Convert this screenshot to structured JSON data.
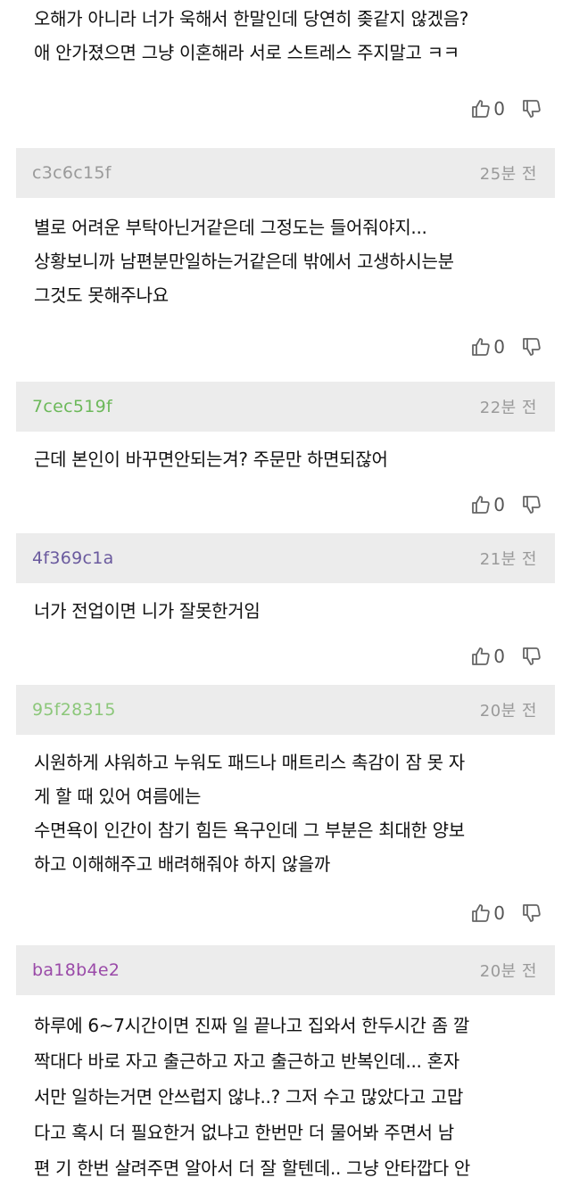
{
  "comments": [
    {
      "user": "",
      "time": "",
      "lines": [
        "오해가 아니라 너가 욱해서 한말인데 당연히 좆같지 않겠음?",
        "애 안가졌으면 그냥 이혼해라 서로 스트레스 주지말고 ㅋㅋ"
      ],
      "likes": "0",
      "user_color": "#999999"
    },
    {
      "user": "c3c6c15f",
      "time": "25분 전",
      "lines": [
        "별로 어려운 부탁아닌거같은데 그정도는 들어줘야지...",
        "상황보니까 남편분만일하는거같은데 밖에서 고생하시는분",
        "그것도 못해주나요"
      ],
      "likes": "0",
      "user_color": "#9a9a9a"
    },
    {
      "user": "7cec519f",
      "time": "22분 전",
      "lines": [
        "근데 본인이 바꾸면안되는겨? 주문만 하면되잖어"
      ],
      "likes": "0",
      "user_color": "#6cb85a"
    },
    {
      "user": "4f369c1a",
      "time": "21분 전",
      "lines": [
        "너가 전업이면 니가 잘못한거임"
      ],
      "likes": "0",
      "user_color": "#6a5a9e"
    },
    {
      "user": "95f28315",
      "time": "20분 전",
      "lines": [
        "시원하게 샤워하고 누워도 패드나 매트리스 촉감이 잠 못 자",
        "게 할 때 있어 여름에는",
        "수면욕이 인간이 참기 힘든 욕구인데 그 부분은 최대한 양보",
        "하고 이해해주고 배려해줘야 하지 않을까"
      ],
      "likes": "0",
      "user_color": "#8cc77a"
    },
    {
      "user": "ba18b4e2",
      "time": "20분 전",
      "lines": [
        "하루에 6~7시간이면 진짜 일 끝나고 집와서 한두시간 좀 깔",
        "짝대다 바로 자고 출근하고 자고 출근하고 반복인데... 혼자",
        "서만 일하는거면 안쓰럽지 않냐..? 그저 수고 많았다고 고맙",
        "다고 혹시 더 필요한거 없냐고 한번만 더 물어봐 주면서 남",
        "편 기 한번 살려주면 알아서 더 잘 할텐데.. 그냥 안타깝다 안"
      ],
      "likes": "",
      "user_color": "#9a4aa8"
    }
  ],
  "icons": {
    "like": "thumbs-up-icon",
    "dislike": "thumbs-down-icon"
  }
}
